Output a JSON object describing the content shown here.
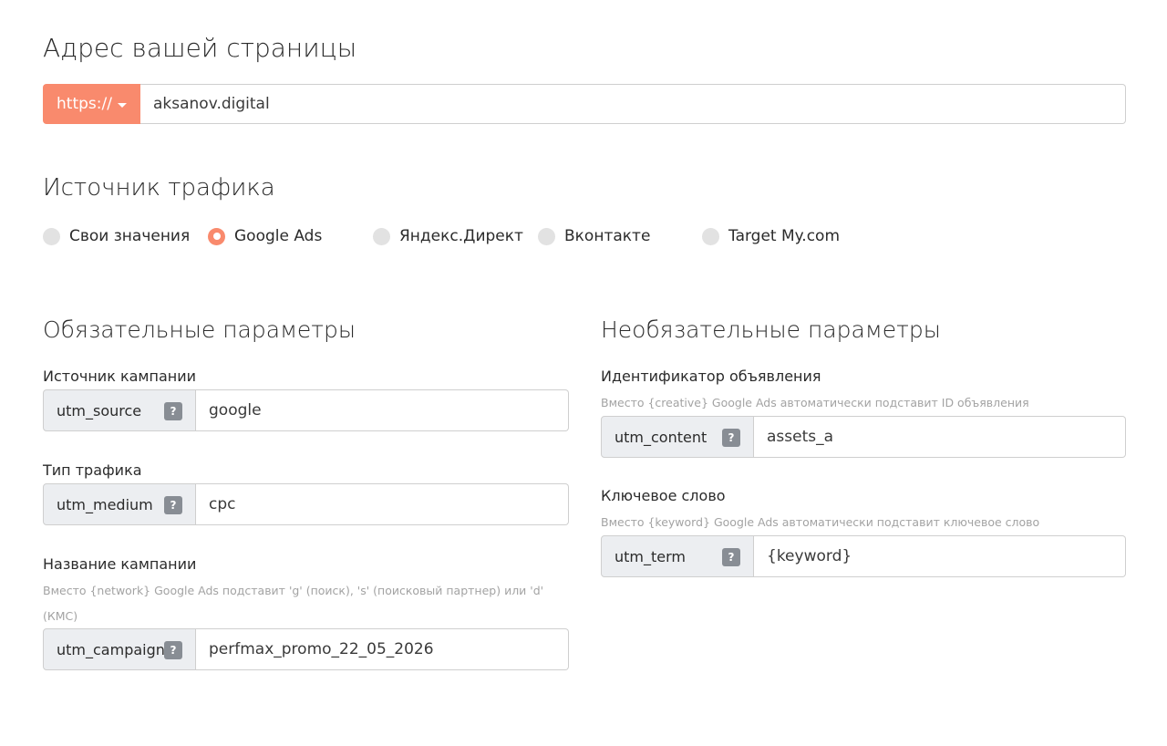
{
  "page": {
    "title": "Адрес вашей страницы"
  },
  "url": {
    "protocol": "https://",
    "value": "aksanov.digital"
  },
  "source": {
    "title": "Источник трафика",
    "options": [
      {
        "label": "Свои значения",
        "selected": false
      },
      {
        "label": "Google Ads",
        "selected": true
      },
      {
        "label": "Яндекс.Директ",
        "selected": false
      },
      {
        "label": "Вконтакте",
        "selected": false
      },
      {
        "label": "Target My.com",
        "selected": false
      }
    ]
  },
  "required": {
    "title": "Обязательные параметры",
    "fields": [
      {
        "label": "Источник кампании",
        "key": "utm_source",
        "value": "google",
        "hint": ""
      },
      {
        "label": "Тип трафика",
        "key": "utm_medium",
        "value": "cpc",
        "hint": ""
      },
      {
        "label": "Название кампании",
        "key": "utm_campaign",
        "value": "perfmax_promo_22_05_2026",
        "hint": "Вместо {network} Google Ads подставит 'g' (поиск), 's' (поисковый партнер) или 'd' (КМС)"
      }
    ]
  },
  "optional": {
    "title": "Необязательные параметры",
    "fields": [
      {
        "label": "Идентификатор объявления",
        "key": "utm_content",
        "value": "assets_a",
        "hint": "Вместо {creative} Google Ads автоматически подставит ID объявления"
      },
      {
        "label": "Ключевое слово",
        "key": "utm_term",
        "value": "{keyword}",
        "hint": "Вместо {keyword} Google Ads автоматически подставит ключевое слово"
      }
    ]
  },
  "help_symbol": "?",
  "colors": {
    "accent": "#f98a6d",
    "key_bg": "#eceef1",
    "help_bg": "#888d94",
    "radio_off": "#e2e2e2"
  }
}
